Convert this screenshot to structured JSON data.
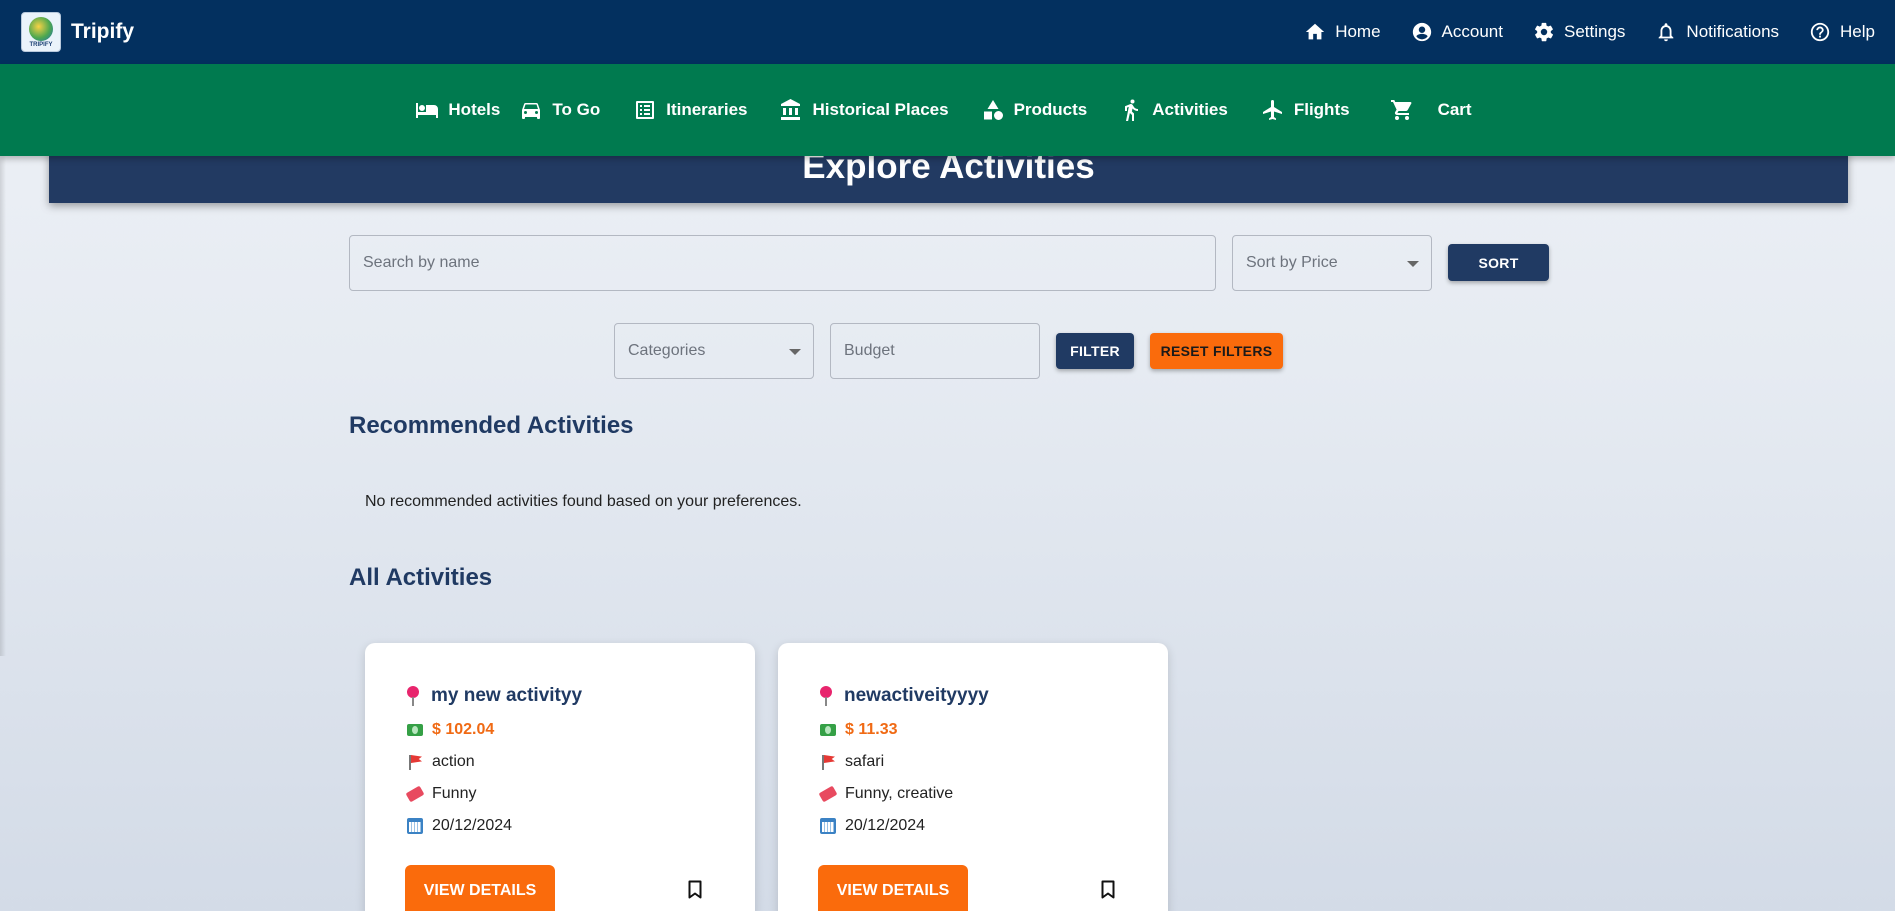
{
  "app": {
    "name": "Tripify",
    "logo_text": "TRIPIFY"
  },
  "topnav": [
    {
      "label": "Home",
      "icon": "home-icon"
    },
    {
      "label": "Account",
      "icon": "account-icon"
    },
    {
      "label": "Settings",
      "icon": "gear-icon"
    },
    {
      "label": "Notifications",
      "icon": "bell-icon"
    },
    {
      "label": "Help",
      "icon": "help-icon"
    }
  ],
  "subnav": [
    {
      "label": "Hotels",
      "icon": "bed-icon"
    },
    {
      "label": "To Go",
      "icon": "car-icon"
    },
    {
      "label": "Itineraries",
      "icon": "list-icon"
    },
    {
      "label": "Historical Places",
      "icon": "museum-icon"
    },
    {
      "label": "Products",
      "icon": "shapes-icon"
    },
    {
      "label": "Activities",
      "icon": "walking-icon"
    },
    {
      "label": "Flights",
      "icon": "plane-icon"
    },
    {
      "label": "Cart",
      "icon": "cart-icon"
    }
  ],
  "page": {
    "title": "Explore Activities"
  },
  "search": {
    "placeholder": "Search by name",
    "value": ""
  },
  "sort": {
    "label": "Sort by Price",
    "button": "SORT"
  },
  "filters": {
    "categories_label": "Categories",
    "budget_placeholder": "Budget",
    "filter_button": "FILTER",
    "reset_button": "RESET FILTERS"
  },
  "recommended": {
    "title": "Recommended Activities",
    "empty_message": "No recommended activities found based on your preferences."
  },
  "all": {
    "title": "All Activities"
  },
  "activities": [
    {
      "name": "my new activityy",
      "price": "$ 102.04",
      "category": "action",
      "tags": "Funny",
      "date": "20/12/2024",
      "button": "VIEW DETAILS"
    },
    {
      "name": "newactiveityyyy",
      "price": "$ 11.33",
      "category": "safari",
      "tags": "Funny, creative",
      "date": "20/12/2024",
      "button": "VIEW DETAILS"
    }
  ],
  "colors": {
    "topbar": "#03305f",
    "subnav": "#007a4f",
    "banner": "#223a62",
    "accent_orange": "#fa6b0c",
    "dark_button": "#203a63"
  }
}
